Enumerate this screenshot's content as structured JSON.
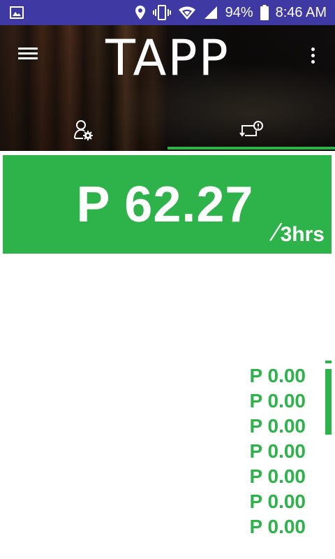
{
  "status_bar": {
    "battery": "94%",
    "time": "8:46 AM",
    "icons": [
      "image-notification-icon",
      "location-icon",
      "vibrate-icon",
      "wifi-icon",
      "signal-icon",
      "battery-icon"
    ]
  },
  "header": {
    "title": "TAPP",
    "menu_icon": "hamburger-menu-icon",
    "more_icon": "overflow-menu-icon"
  },
  "tabs": [
    {
      "icon": "user-settings-icon",
      "active": false
    },
    {
      "icon": "history-icon",
      "active": true
    }
  ],
  "rate": {
    "amount": "P 62.27",
    "per_slash": "/",
    "per_unit": "3hrs"
  },
  "history": [
    "P 0.00",
    "P 0.00",
    "P 0.00",
    "P 0.00",
    "P 0.00",
    "P 0.00",
    "P 0.00"
  ],
  "colors": {
    "status_bar": "#3f3aa3",
    "accent_green": "#2db34a",
    "text_white": "#ffffff"
  }
}
